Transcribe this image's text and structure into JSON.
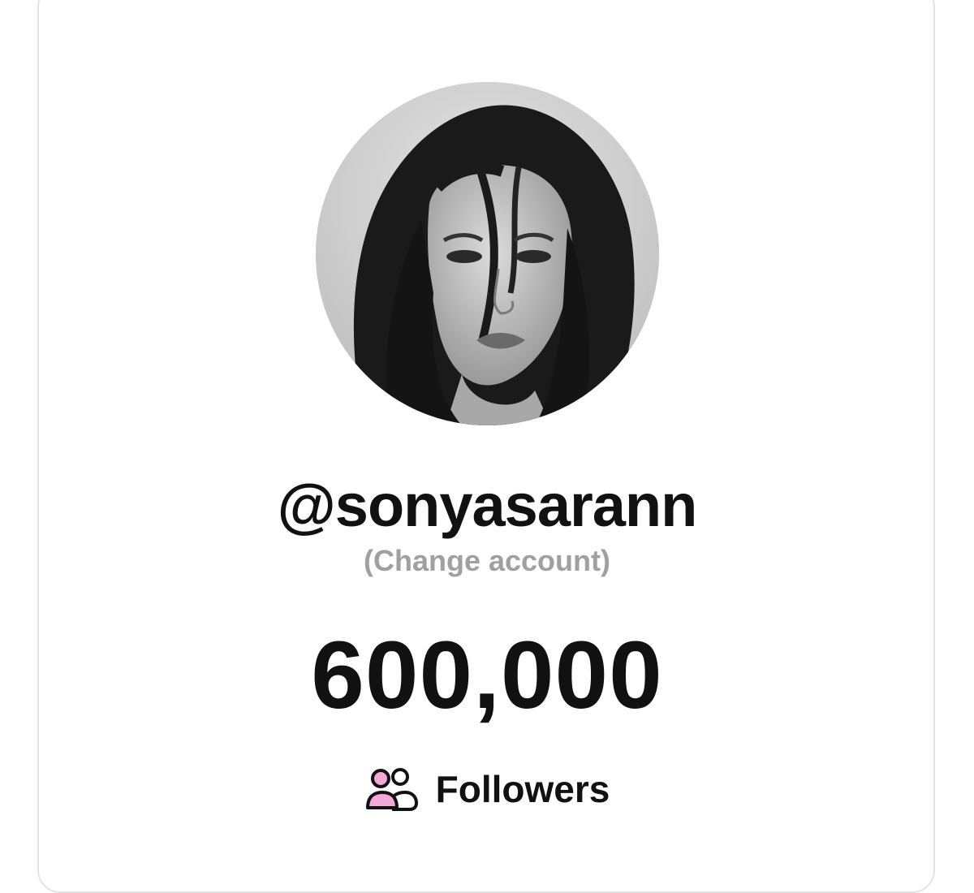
{
  "profile": {
    "username": "@sonyasarann",
    "change_account_label": "(Change account)"
  },
  "stats": {
    "count": "600,000",
    "label": "Followers",
    "icon": "followers-icon"
  },
  "colors": {
    "text": "#111111",
    "muted": "#a0a0a0",
    "border": "#e4e4e4",
    "icon_accent": "#f2a8d8"
  }
}
